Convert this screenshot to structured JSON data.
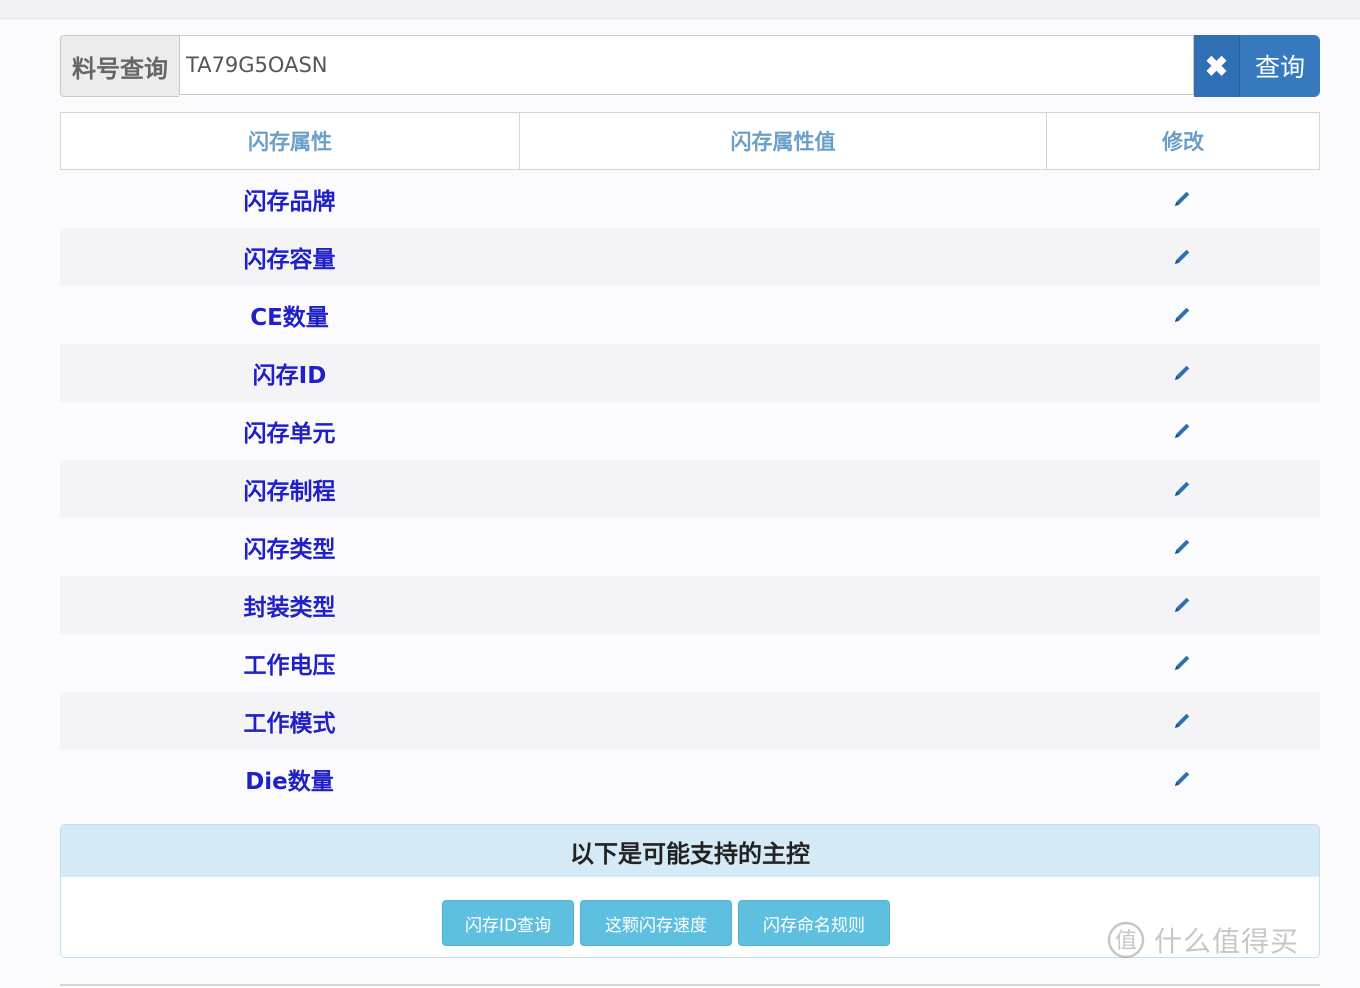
{
  "search": {
    "label": "料号查询",
    "value": "TA79G5OASN",
    "clear_icon": "✖",
    "query_label": "查询"
  },
  "table": {
    "headers": [
      "闪存属性",
      "闪存属性值",
      "修改"
    ],
    "rows": [
      {
        "label": "闪存品牌",
        "value": ""
      },
      {
        "label": "闪存容量",
        "value": ""
      },
      {
        "label": "CE数量",
        "value": ""
      },
      {
        "label": "闪存ID",
        "value": ""
      },
      {
        "label": "闪存单元",
        "value": ""
      },
      {
        "label": "闪存制程",
        "value": ""
      },
      {
        "label": "闪存类型",
        "value": ""
      },
      {
        "label": "封装类型",
        "value": ""
      },
      {
        "label": "工作电压",
        "value": ""
      },
      {
        "label": "工作模式",
        "value": ""
      },
      {
        "label": "Die数量",
        "value": ""
      }
    ],
    "edit_icon": "pencil-icon"
  },
  "controllers": {
    "title": "以下是可能支持的主控",
    "buttons": [
      "闪存ID查询",
      "这颗闪存速度",
      "闪存命名规则"
    ]
  },
  "watermark": {
    "text": "什么值得买",
    "mark": "值"
  },
  "colors": {
    "accent": "#3779bf",
    "label_blue": "#2020c8",
    "header_blue": "#6a9fc9",
    "panel_head": "#d4eaf6",
    "info_button": "#5ec0de"
  }
}
